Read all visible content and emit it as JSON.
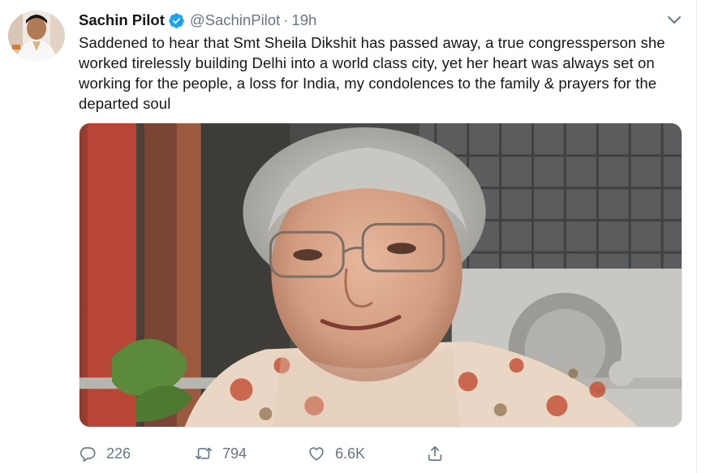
{
  "tweet": {
    "author_name": "Sachin Pilot",
    "handle": "@SachinPilot",
    "separator": "·",
    "time": "19h",
    "text": "Saddened to hear that Smt Sheila Dikshit has passed away, a true congressperson she worked tirelessly building Delhi into a world class city, yet her heart was always set on working for the people, a loss for India, my condolences to the family & prayers for the departed soul"
  },
  "actions": {
    "reply_count": "226",
    "retweet_count": "794",
    "like_count": "6.6K"
  },
  "icons": {
    "verified": "verified-badge-icon",
    "caret": "chevron-down-icon",
    "reply": "reply-icon",
    "retweet": "retweet-icon",
    "like": "heart-icon",
    "share": "share-icon"
  },
  "colors": {
    "verified_blue": "#1da1f2",
    "muted_text": "#657786",
    "primary_text": "#14171a"
  }
}
